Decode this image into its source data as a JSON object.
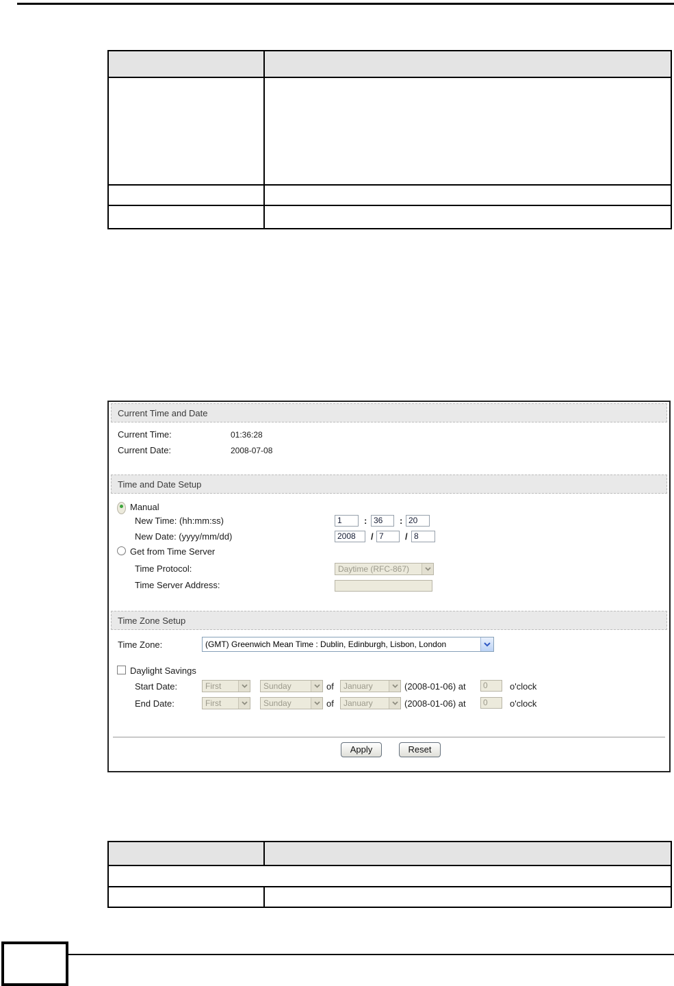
{
  "colors": {
    "section_header_bg": "#e9e9e9",
    "table_header_bg": "#e4e4e4",
    "disabled_bg": "#eceadc",
    "disabled_text": "#9c9a8c",
    "enabled_select_border": "#86a0b8",
    "dropdown_arrow_blue": "#2f58c3",
    "radio_selected_dot": "#3da53d"
  },
  "figure": {
    "sections": {
      "current": "Current Time and Date",
      "setup": "Time and Date Setup",
      "timezone": "Time Zone Setup"
    },
    "current_time": {
      "label": "Current Time:",
      "value": "01:36:28"
    },
    "current_date": {
      "label": "Current Date:",
      "value": "2008-07-08"
    },
    "manual": {
      "label": "Manual"
    },
    "new_time": {
      "label": "New Time: (hh:mm:ss)",
      "h": "1",
      "m": "36",
      "s": "20",
      "sep": ":"
    },
    "new_date": {
      "label": "New Date: (yyyy/mm/dd)",
      "y": "2008",
      "m": "7",
      "d": "8",
      "sep": "/"
    },
    "get_from_server": {
      "label": "Get from Time Server"
    },
    "time_protocol": {
      "label": "Time Protocol:",
      "value": "Daytime (RFC-867)"
    },
    "time_server": {
      "label": "Time Server Address:",
      "value": ""
    },
    "time_zone": {
      "label": "Time Zone:",
      "value": "(GMT) Greenwich Mean Time : Dublin, Edinburgh, Lisbon, London"
    },
    "daylight": {
      "label": "Daylight Savings"
    },
    "dst_rows": [
      {
        "label": "Start Date:",
        "week": "First",
        "day": "Sunday",
        "of": "of",
        "month": "January",
        "at": "(2008-01-06) at",
        "hour": "0",
        "oclock": "o'clock"
      },
      {
        "label": "End Date:",
        "week": "First",
        "day": "Sunday",
        "of": "of",
        "month": "January",
        "at": "(2008-01-06) at",
        "hour": "0",
        "oclock": "o'clock"
      }
    ],
    "buttons": {
      "apply": "Apply",
      "reset": "Reset"
    }
  }
}
